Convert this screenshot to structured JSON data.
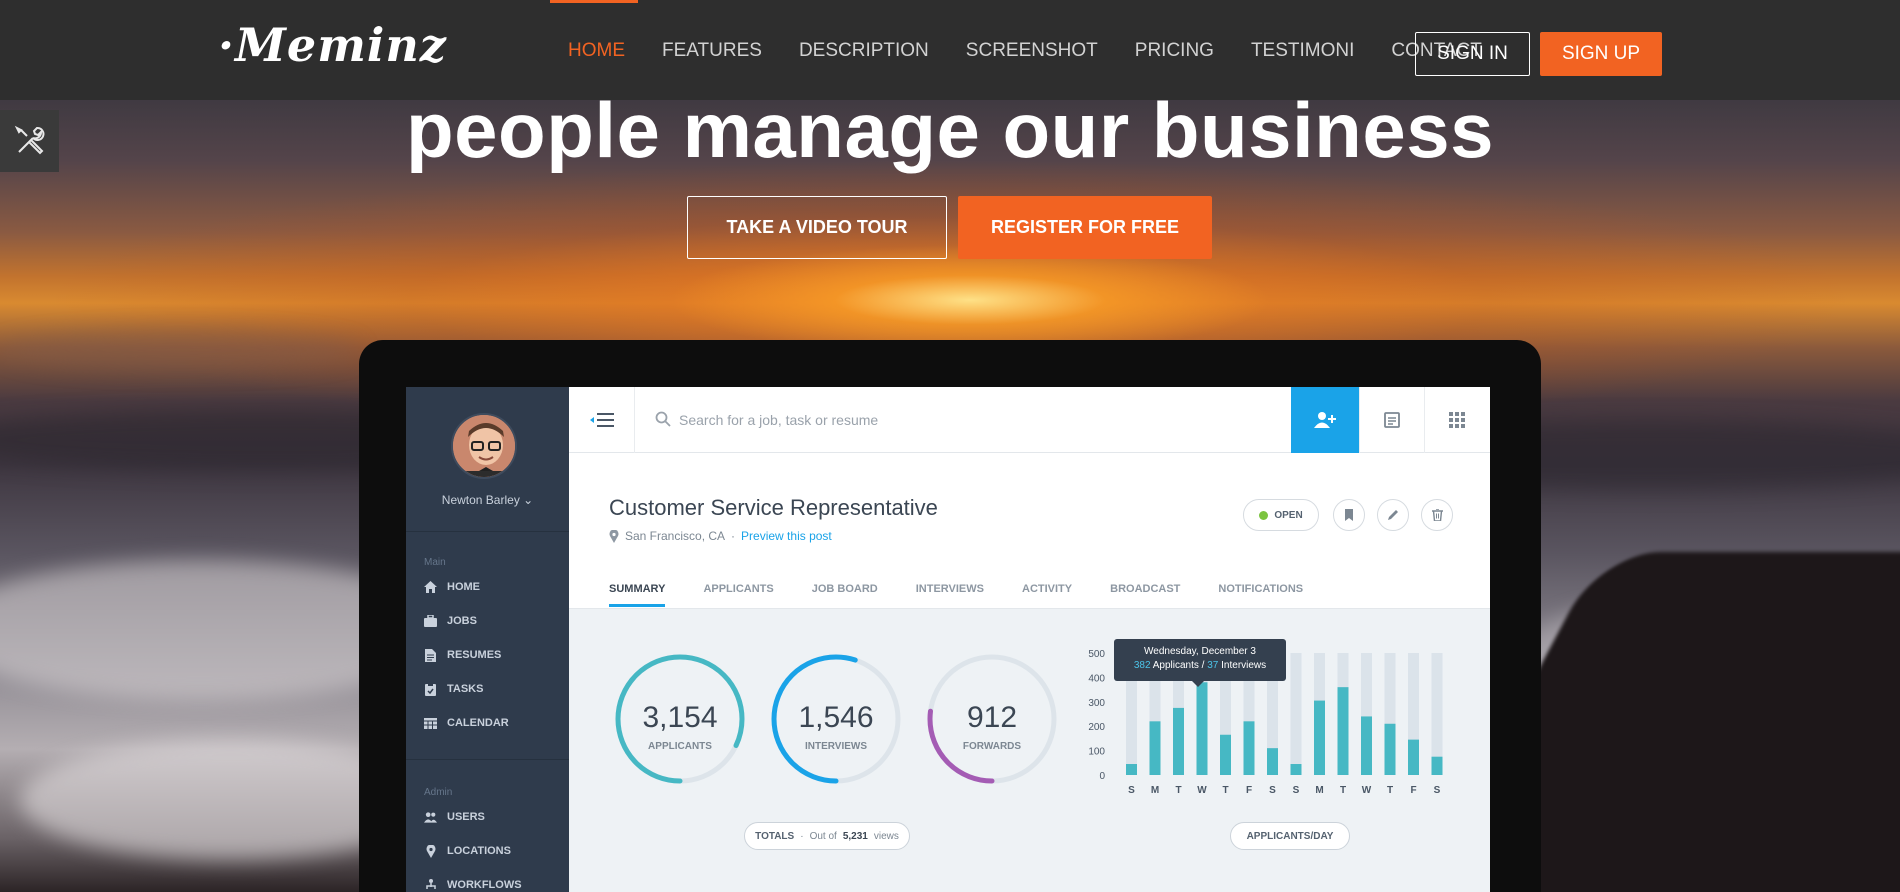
{
  "brand": {
    "logo_text": "·Meminz"
  },
  "nav": {
    "links": [
      "HOME",
      "FEATURES",
      "DESCRIPTION",
      "SCREENSHOT",
      "PRICING",
      "TESTIMONI",
      "CONTACT"
    ],
    "active": "HOME",
    "signin_label": "SIGN IN",
    "signup_label": "SIGN UP"
  },
  "hero": {
    "headline": "people manage our business",
    "tour_label": "TAKE A VIDEO TOUR",
    "register_label": "REGISTER FOR FREE"
  },
  "colors": {
    "accent": "#f26322",
    "nav_bg": "#2e2e2e",
    "app_blue": "#1aa3e8",
    "app_teal": "#46b8c4",
    "app_purple": "#a45cb4"
  },
  "app": {
    "user": {
      "name": "Newton Barley ⌄"
    },
    "sidebar": {
      "main_heading": "Main",
      "main_items": [
        {
          "label": "HOME",
          "icon": "home-icon"
        },
        {
          "label": "JOBS",
          "icon": "briefcase-icon"
        },
        {
          "label": "RESUMES",
          "icon": "document-icon"
        },
        {
          "label": "TASKS",
          "icon": "clipboard-icon"
        },
        {
          "label": "CALENDAR",
          "icon": "calendar-icon"
        }
      ],
      "admin_heading": "Admin",
      "admin_items": [
        {
          "label": "USERS",
          "icon": "users-icon"
        },
        {
          "label": "LOCATIONS",
          "icon": "map-pin-icon"
        },
        {
          "label": "WORKFLOWS",
          "icon": "workflow-icon"
        }
      ]
    },
    "search": {
      "placeholder": "Search for a job, task or resume"
    },
    "job": {
      "title": "Customer Service Representative",
      "location": "San Francisco, CA",
      "separator": "·",
      "preview_label": "Preview this post",
      "status": "OPEN"
    },
    "tabs": [
      "SUMMARY",
      "APPLICANTS",
      "JOB BOARD",
      "INTERVIEWS",
      "ACTIVITY",
      "BROADCAST",
      "NOTIFICATIONS"
    ],
    "active_tab": "SUMMARY",
    "stats": [
      {
        "value": "3,154",
        "label": "APPLICANTS",
        "fraction": 0.82,
        "color": "#46b8c4"
      },
      {
        "value": "1,546",
        "label": "INTERVIEWS",
        "fraction": 0.55,
        "color": "#1aa3e8"
      },
      {
        "value": "912",
        "label": "FORWARDS",
        "fraction": 0.27,
        "color": "#a45cb4"
      }
    ],
    "totals": {
      "label": "TOTALS",
      "sep": "·",
      "out_of": "Out of",
      "views": "5,231",
      "views_suffix": "views"
    },
    "chart_footer": "APPLICANTS/DAY",
    "tooltip": {
      "date": "Wednesday, December 3",
      "applicants": "382",
      "applicants_label": "Applicants /",
      "interviews": "37",
      "interviews_label": "Interviews"
    }
  },
  "chart_data": {
    "type": "bar",
    "categories": [
      "S",
      "M",
      "T",
      "W",
      "T",
      "F",
      "S",
      "S",
      "M",
      "T",
      "W",
      "T",
      "F",
      "S"
    ],
    "values": [
      45,
      220,
      275,
      380,
      165,
      220,
      110,
      45,
      305,
      360,
      240,
      210,
      145,
      75
    ],
    "background_max": [
      500,
      500,
      500,
      500,
      500,
      500,
      500,
      500,
      500,
      500,
      500,
      500,
      500,
      500
    ],
    "ylim": [
      0,
      500
    ],
    "yticks": [
      0,
      100,
      200,
      300,
      400,
      500
    ],
    "title": "",
    "xlabel": "",
    "ylabel": "",
    "grid": false
  }
}
